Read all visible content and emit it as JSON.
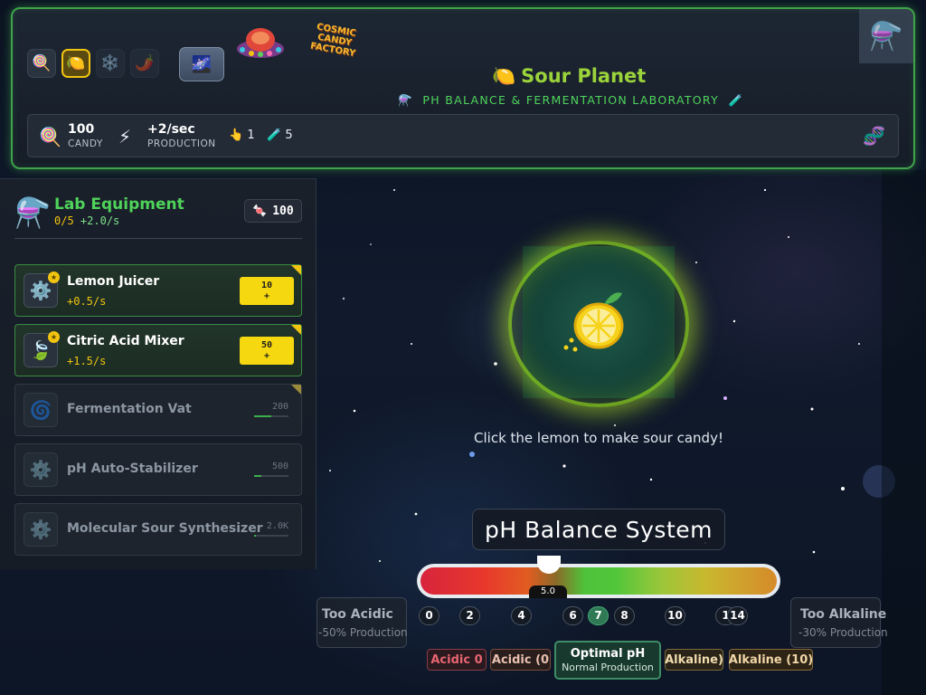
{
  "header": {
    "logo_text": "COSMIC CANDY FACTORY",
    "planet_buttons": [
      {
        "icon": "🍭",
        "name": "candy-planet",
        "state": "normal"
      },
      {
        "icon": "🍋",
        "name": "sour-planet",
        "state": "active"
      },
      {
        "icon": "❄️",
        "name": "frost-planet",
        "state": "locked"
      },
      {
        "icon": "🌶️",
        "name": "spicy-planet",
        "state": "locked"
      }
    ],
    "galaxy_icon": "🌌",
    "title_icon": "🍋",
    "title": "Sour Planet",
    "subtitle": "PH BALANCE & FERMENTATION LABORATORY",
    "subtitle_icon_left": "⚗️",
    "subtitle_icon_right": "🧪",
    "corner_icon": "⚗️"
  },
  "stats": {
    "candy_icon": "🍭",
    "candy_value": "100",
    "candy_label": "CANDY",
    "production_icon": "⚡",
    "production_value": "+2/sec",
    "production_label": "PRODUCTION",
    "click_icon": "👆",
    "click_value": "1",
    "test_tube_icon": "🧪",
    "test_tube_value": "5",
    "dna_icon": "🧬"
  },
  "panel": {
    "icon": "⚗️",
    "title": "Lab Equipment",
    "owned": "0/5",
    "rate": "+2.0/s",
    "candy_badge_icon": "🍬",
    "candy_badge_value": "100",
    "items": [
      {
        "name": "Lemon Juicer",
        "rate": "+0.5/s",
        "cost": "10",
        "plus": "+",
        "icon": "⚙️",
        "state": "buyable",
        "progress": 1.0
      },
      {
        "name": "Citric Acid Mixer",
        "rate": "+1.5/s",
        "cost": "50",
        "plus": "+",
        "icon": "🍃",
        "state": "buyable",
        "progress": 1.0
      },
      {
        "name": "Fermentation Vat",
        "cost": "200",
        "icon": "🌀",
        "state": "locked",
        "progress": 0.5
      },
      {
        "name": "pH Auto-Stabilizer",
        "cost": "500",
        "icon": "⚙️",
        "state": "locked",
        "progress": 0.2
      },
      {
        "name": "Molecular Sour Synthesizer",
        "cost": "2.0K",
        "icon": "⚙️",
        "state": "locked",
        "progress": 0.05
      }
    ]
  },
  "center": {
    "lemon_icon": "🍋",
    "hint": "Click the lemon to make sour candy!"
  },
  "ph": {
    "title": "pH Balance System",
    "current_value": "5.0",
    "current_ph": 5.0,
    "ticks": [
      "0",
      "2",
      "4",
      "6",
      "7",
      "8",
      "10",
      "1",
      "14"
    ],
    "optimal_tick": "7",
    "too_acidic_title": "Too Acidic",
    "too_acidic_sub": "-50% Production",
    "too_alkaline_title": "Too Alkaline",
    "too_alkaline_sub": "-30% Production",
    "zones": [
      "Acidic 0",
      "Acidic (0",
      "Alkaline)",
      "Alkaline (10)"
    ],
    "optimal_title": "Optimal pH",
    "optimal_sub": "Normal Production",
    "colors": {
      "acidic": "#d8243c",
      "neutral": "#4ec23a",
      "alkaline": "#d68a2a"
    }
  }
}
